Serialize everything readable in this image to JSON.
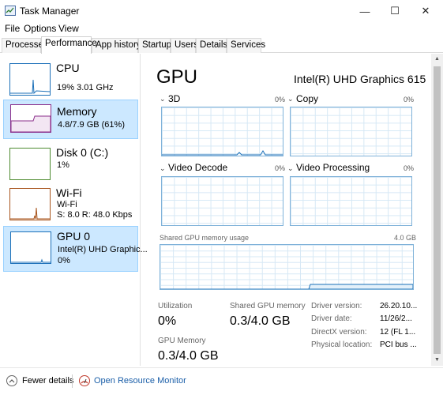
{
  "window": {
    "title": "Task Manager",
    "min_glyph": "—",
    "max_glyph": "☐",
    "close_glyph": "✕"
  },
  "menu": [
    "File",
    "Options",
    "View"
  ],
  "tabs": [
    "Processes",
    "Performance",
    "App history",
    "Startup",
    "Users",
    "Details",
    "Services"
  ],
  "active_tab": "Performance",
  "resources": [
    {
      "name": "CPU",
      "line1": "19% 3.01 GHz",
      "line2": "",
      "line3": "",
      "color": "#1b6fb8",
      "icon": "cpu-graph-icon"
    },
    {
      "name": "Memory",
      "line1": "4.8/7.9 GB (61%)",
      "line2": "",
      "line3": "",
      "color": "#8b2f8b",
      "icon": "memory-graph-icon"
    },
    {
      "name": "Disk 0 (C:)",
      "line1": "1%",
      "line2": "",
      "line3": "",
      "color": "#4d8b2f",
      "icon": "disk-graph-icon"
    },
    {
      "name": "Wi-Fi",
      "line1": "Wi-Fi",
      "line2": "S: 8.0  R: 48.0 Kbps",
      "line3": "",
      "color": "#a8541c",
      "icon": "wifi-graph-icon"
    },
    {
      "name": "GPU 0",
      "line1": "Intel(R) UHD Graphic...",
      "line2": "0%",
      "line3": "",
      "color": "#1b6fb8",
      "icon": "gpu-graph-icon"
    }
  ],
  "detail": {
    "title": "GPU",
    "adapter": "Intel(R) UHD Graphics 615",
    "graphs": [
      {
        "label": "3D",
        "percent": "0%"
      },
      {
        "label": "Copy",
        "percent": "0%"
      },
      {
        "label": "Video Decode",
        "percent": "0%"
      },
      {
        "label": "Video Processing",
        "percent": "0%"
      }
    ],
    "shared_graph_label": "Shared GPU memory usage",
    "shared_graph_max": "4.0 GB",
    "stats": {
      "utilization_label": "Utilization",
      "utilization_value": "0%",
      "shared_label": "Shared GPU memory",
      "shared_value": "0.3/4.0 GB",
      "gpu_memory_label": "GPU Memory",
      "gpu_memory_value": "0.3/4.0 GB"
    },
    "info": [
      {
        "label": "Driver version:",
        "value": "26.20.10..."
      },
      {
        "label": "Driver date:",
        "value": "11/26/2..."
      },
      {
        "label": "DirectX version:",
        "value": "12 (FL 1..."
      },
      {
        "label": "Physical location:",
        "value": "PCI bus ..."
      }
    ]
  },
  "footer": {
    "fewer_details": "Fewer details",
    "resource_monitor": "Open Resource Monitor"
  },
  "colors": {
    "selection": "#cce8ff",
    "graph_border": "#7fb2d9",
    "link": "#1a5ea8"
  }
}
